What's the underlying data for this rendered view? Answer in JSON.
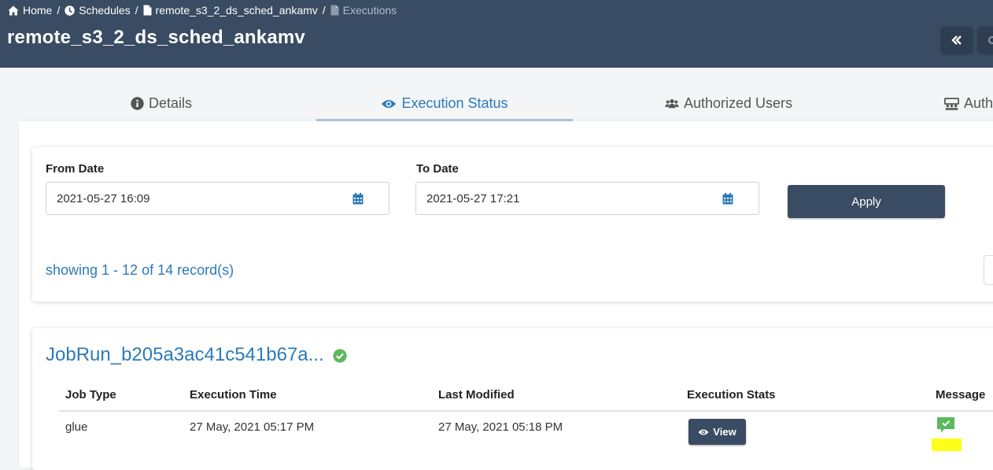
{
  "breadcrumb": [
    {
      "label": "Home",
      "icon": "home-icon"
    },
    {
      "label": "Schedules",
      "icon": "clock-icon"
    },
    {
      "label": "remote_s3_2_ds_sched_ankamv",
      "icon": "file-icon"
    },
    {
      "label": "Executions",
      "icon": "file-icon"
    }
  ],
  "breadcrumb_separator": "/",
  "page_title": "remote_s3_2_ds_sched_ankamv",
  "tabs": [
    {
      "label": "Details",
      "icon": "info-circle-icon"
    },
    {
      "label": "Execution Status",
      "icon": "eye-icon",
      "active": true
    },
    {
      "label": "Authorized Users",
      "icon": "users-icon"
    },
    {
      "label": "Auth",
      "icon": "users-group-icon"
    }
  ],
  "filter": {
    "from_label": "From Date",
    "from_value": "2021-05-27 16:09",
    "to_label": "To Date",
    "to_value": "2021-05-27 17:21",
    "apply_label": "Apply",
    "records_text": "showing 1 - 12 of 14 record(s)"
  },
  "job_run": {
    "title": "JobRun_b205a3ac41c541b67a...",
    "status": "success",
    "columns": [
      "Job Type",
      "Execution Time",
      "Last Modified",
      "Execution Stats",
      "Message"
    ],
    "rows": [
      {
        "job_type": "glue",
        "execution_time": "27 May, 2021 05:17 PM",
        "last_modified": "27 May, 2021 05:18 PM",
        "stats_label": "View"
      }
    ]
  },
  "colors": {
    "header_bg": "#3a4c63",
    "accent": "#2c7ab8",
    "success": "#5cb85c",
    "highlight": "#ffff1a"
  }
}
